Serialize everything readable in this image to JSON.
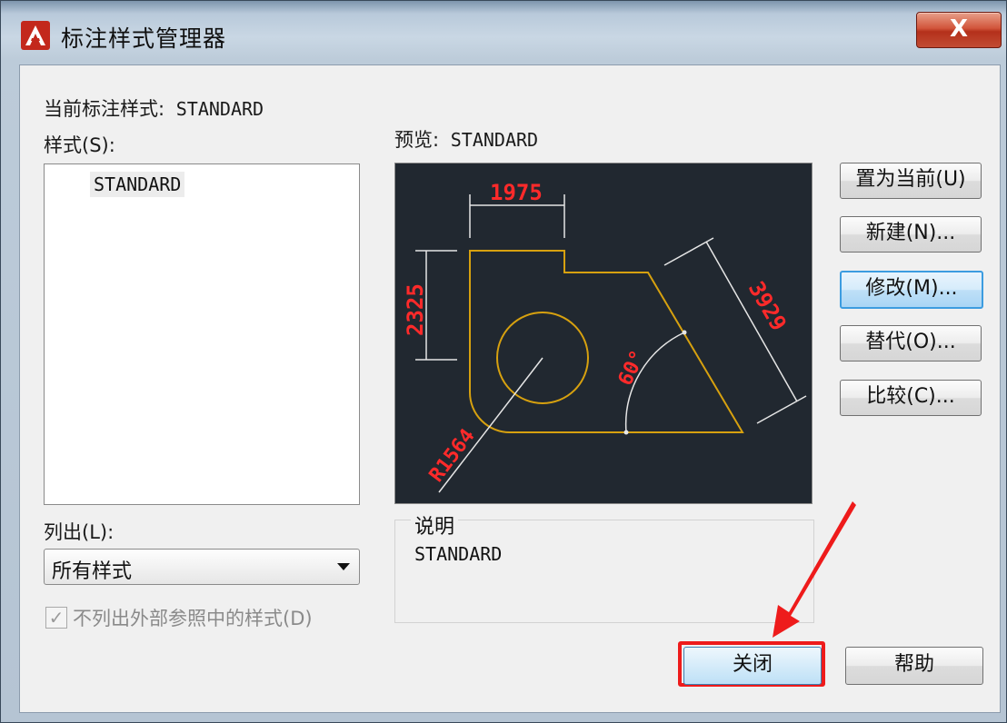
{
  "window": {
    "title": "标注样式管理器",
    "close_glyph": "X"
  },
  "current_style": {
    "label": "当前标注样式:",
    "value": "STANDARD"
  },
  "styles": {
    "label": "样式(S):",
    "items": [
      "STANDARD"
    ]
  },
  "preview": {
    "label": "预览:",
    "value": "STANDARD",
    "dims": {
      "top": "1975",
      "left": "2325",
      "slant": "3929",
      "angle": "60°",
      "radius": "R1564"
    }
  },
  "list_filter": {
    "label": "列出(L):",
    "selected": "所有样式"
  },
  "exclude_xref": {
    "label": "不列出外部参照中的样式(D)",
    "checked": true
  },
  "description": {
    "title": "说明",
    "text": "STANDARD"
  },
  "side_buttons": {
    "set_current": "置为当前(U)",
    "new": "新建(N)...",
    "modify": "修改(M)...",
    "override": "替代(O)...",
    "compare": "比较(C)..."
  },
  "bottom_buttons": {
    "close": "关闭",
    "help": "帮助"
  },
  "colors": {
    "geometry": "#d7a10f",
    "dimension_text": "#ff2a2a",
    "highlight": "#ee1b1b"
  }
}
